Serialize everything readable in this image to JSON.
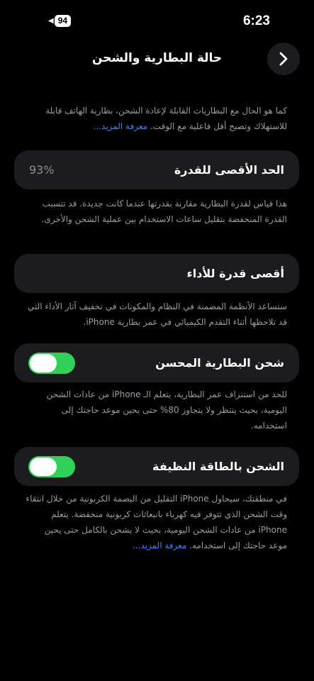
{
  "status": {
    "time": "6:23",
    "battery_level": "94"
  },
  "nav": {
    "title": "حالة البطارية والشحن"
  },
  "intro": {
    "text": "كما هو الحال مع البطاريات القابلة لإعادة الشحن، بطارية الهاتف قابلة للاستهلاك وتصبح أقل فاعلية مع الوقت.",
    "link": "معرفة المزيد..."
  },
  "max_capacity": {
    "label": "الحد الأقصى للقدرة",
    "value": "93%",
    "description": "هذا قياس لقدرة البطارية مقارنة بقدرتها عندما كانت جديدة. قد تتسبب القدرة المنخفضة بتقليل ساعات الاستخدام بين عملية الشحن والأخرى."
  },
  "peak_performance": {
    "label": "أقصى قدرة للأداء",
    "description": "ستساعد الأنظمة المضمنة في النظام والمكونات في تخفيف آثار الأداء التي قد تلاحظها أثناء التقدم الكيميائي في عمر بطارية iPhone."
  },
  "optimized_charging": {
    "label": "شحن البطارية المحسن",
    "enabled": true,
    "description": "للحد من استنزاف عمر البطارية، يتعلم الـ iPhone من عادات الشحن اليومية، بحيث ينتظر ولا يتجاوز 80% حتى يحين موعد حاجتك إلى استخدامه."
  },
  "clean_energy": {
    "label": "الشحن بالطاقة النظيفة",
    "enabled": true,
    "description": "في منطقتك، سيحاول iPhone التقليل من البصمة الكربونية من خلال انتقاء وقت الشحن الذي تتوفر فيه كهرباء بانبعاثات كربونية منخفضة. يتعلم iPhone من عادات الشحن اليومية، بحيث لا يشحن بالكامل حتى يحين موعد حاجتك إلى استخدامه.",
    "link": "معرفة المزيد..."
  },
  "colors": {
    "accent_green": "#30d158",
    "link_blue": "#3b82f6",
    "card_bg": "#1c1c1e",
    "secondary_text": "#9b9ba1"
  }
}
